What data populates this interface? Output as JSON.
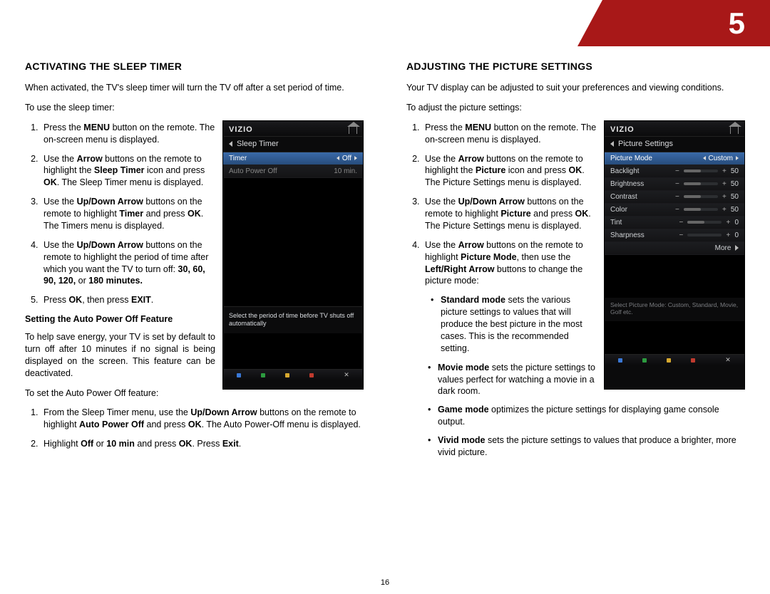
{
  "chapter": "5",
  "page_number": "16",
  "left": {
    "heading": "ACTIVATING THE SLEEP TIMER",
    "intro": "When activated, the TV's sleep timer will turn the TV off after a set period of time.",
    "lead": "To use the sleep timer:",
    "steps": {
      "s1_a": "Press the ",
      "s1_b": "MENU",
      "s1_c": " button on the remote. The on-screen menu is displayed.",
      "s2_a": "Use the ",
      "s2_b": "Arrow",
      "s2_c": " buttons on the remote to highlight the ",
      "s2_d": "Sleep Timer",
      "s2_e": " icon and press ",
      "s2_f": "OK",
      "s2_g": ". The Sleep Timer menu is displayed.",
      "s3_a": "Use the ",
      "s3_b": "Up/Down Arrow",
      "s3_c": " buttons on the remote to highlight ",
      "s3_d": "Timer",
      "s3_e": " and press ",
      "s3_f": "OK",
      "s3_g": ". The Timers menu is displayed.",
      "s4_a": "Use the ",
      "s4_b": "Up/Down Arrow",
      "s4_c": " buttons on the remote to highlight the period of time after which you want the TV to turn off: ",
      "s4_d": "30, 60, 90, 120,",
      "s4_e": " or ",
      "s4_f": "180 minutes.",
      "s5_a": "Press ",
      "s5_b": "OK",
      "s5_c": ", then press ",
      "s5_d": "EXIT",
      "s5_e": "."
    },
    "sub_heading": "Setting the Auto Power Off Feature",
    "sub_para": "To help save energy, your TV is set by default to turn off after 10 minutes if no signal is being displayed on the screen. This feature can be deactivated.",
    "sub_lead": "To set the Auto Power Off feature:",
    "sub_steps": {
      "a1_a": "From the Sleep Timer menu, use the ",
      "a1_b": "Up/Down Arrow",
      "a1_c": " buttons on the remote to highlight ",
      "a1_d": "Auto Power Off",
      "a1_e": " and press ",
      "a1_f": "OK",
      "a1_g": ". The Auto Power-Off menu is displayed.",
      "a2_a": "Highlight ",
      "a2_b": "Off",
      "a2_c": " or ",
      "a2_d": "10 min",
      "a2_e": " and press ",
      "a2_f": "OK",
      "a2_g": ". Press ",
      "a2_h": "Exit",
      "a2_i": "."
    },
    "tv": {
      "brand": "VIZIO",
      "crumb": "Sleep Timer",
      "row1_label": "Timer",
      "row1_val": "Off",
      "row2_label": "Auto Power Off",
      "row2_val": "10 min.",
      "msg": "Select the period of time before TV shuts off automatically"
    }
  },
  "right": {
    "heading": "ADJUSTING THE PICTURE SETTINGS",
    "intro": "Your TV display can be adjusted to suit your preferences and viewing conditions.",
    "lead": "To adjust the picture settings:",
    "steps": {
      "s1_a": "Press the ",
      "s1_b": "MENU",
      "s1_c": " button on the remote. The on-screen menu is displayed.",
      "s2_a": "Use the ",
      "s2_b": "Arrow",
      "s2_c": " buttons on the remote to highlight the ",
      "s2_d": "Picture",
      "s2_e": " icon and press ",
      "s2_f": "OK",
      "s2_g": ". The Picture Settings menu is displayed.",
      "s3_a": "Use the ",
      "s3_b": "Up/Down Arrow",
      "s3_c": " buttons on the remote to highlight ",
      "s3_d": "Picture",
      "s3_e": " and press ",
      "s3_f": "OK",
      "s3_g": ". The Picture Settings menu is displayed.",
      "s4_a": "Use the ",
      "s4_b": "Arrow",
      "s4_c": " buttons on the remote to highlight ",
      "s4_d": "Picture Mode",
      "s4_e": ", then use the ",
      "s4_f": "Left/Right Arrow",
      "s4_g": " buttons to change the picture mode:"
    },
    "modes": {
      "m1_a": "Standard mode",
      "m1_b": " sets the various picture settings to values that will produce the best picture in the most cases. This is the recommended setting.",
      "m2_a": "Movie mode",
      "m2_b": " sets the picture settings to values perfect for watching a movie in a dark room.",
      "m3_a": "Game mode",
      "m3_b": " optimizes the picture settings for displaying game console output.",
      "m4_a": "Vivid mode",
      "m4_b": " sets the picture settings to values that produce a brighter, more vivid picture."
    },
    "tv": {
      "brand": "VIZIO",
      "crumb": "Picture Settings",
      "mode_label": "Picture Mode",
      "mode_val": "Custom",
      "rows": {
        "backlight": "Backlight",
        "backlight_v": "50",
        "brightness": "Brightness",
        "brightness_v": "50",
        "contrast": "Contrast",
        "contrast_v": "50",
        "color": "Color",
        "color_v": "50",
        "tint": "Tint",
        "tint_v": "0",
        "sharp": "Sharpness",
        "sharp_v": "0"
      },
      "more": "More",
      "hint": "Select Picture Mode: Custom, Standard, Movie, Golf etc."
    }
  }
}
